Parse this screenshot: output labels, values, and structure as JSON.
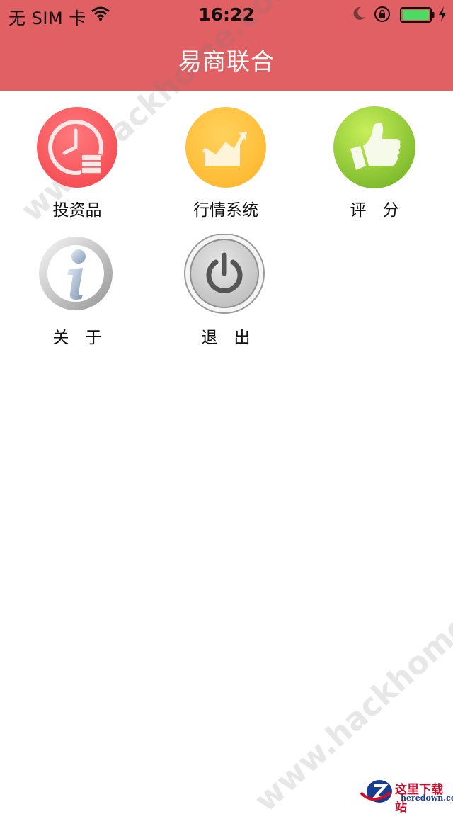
{
  "status_bar": {
    "carrier": "无 SIM 卡",
    "time": "16:22",
    "icons": [
      "wifi-icon",
      "moon-icon",
      "orientation-lock-icon",
      "battery-icon",
      "charging-bolt-icon"
    ]
  },
  "header": {
    "title": "易商联合"
  },
  "menu": {
    "items": [
      {
        "label": "投资品",
        "icon": "clock-coins-icon",
        "color": "#ff5a5f"
      },
      {
        "label": "行情系统",
        "icon": "trend-chart-icon",
        "color": "#ffc43d"
      },
      {
        "label": "评　分",
        "icon": "thumbs-up-icon",
        "color": "#8cc63f"
      },
      {
        "label": "关　于",
        "icon": "info-icon",
        "color": "#b0b0b0"
      },
      {
        "label": "退　出",
        "icon": "power-icon",
        "color": "#c8c8c8"
      }
    ]
  },
  "watermark": {
    "text": "www.hackhome.com",
    "corner_title": "这里下载站",
    "corner_url": "heredown.com"
  },
  "colors": {
    "header_bg": "#e06063",
    "background": "#ffffff"
  }
}
